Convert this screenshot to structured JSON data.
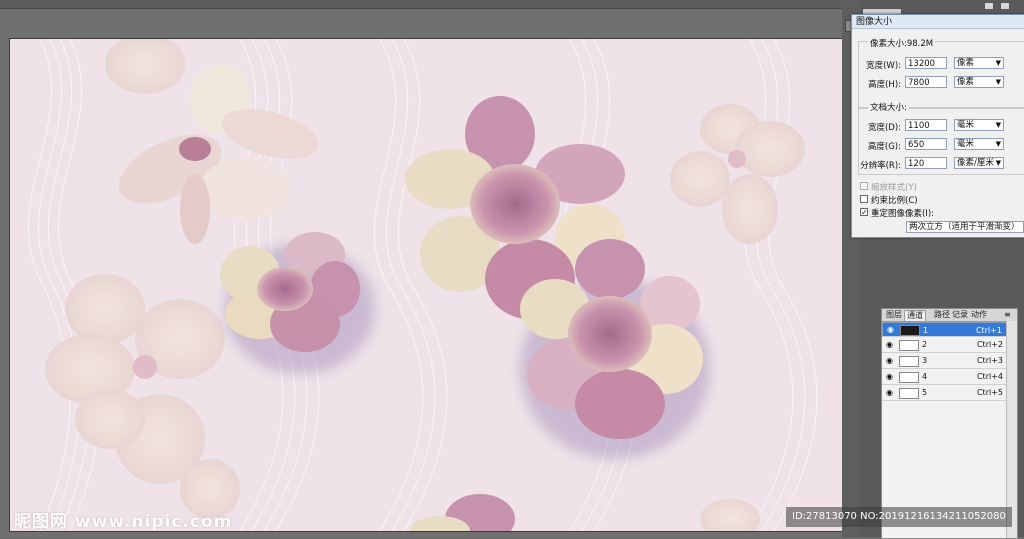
{
  "dialog": {
    "title": "图像大小",
    "pixel_section": "像素大小:98.2M",
    "pixel_width_label": "宽度(W):",
    "pixel_width_value": "13200",
    "pixel_width_unit": "像素",
    "pixel_height_label": "高度(H):",
    "pixel_height_value": "7800",
    "pixel_height_unit": "像素",
    "doc_section": "文档大小:",
    "doc_width_label": "宽度(D):",
    "doc_width_value": "1100",
    "doc_width_unit": "毫米",
    "doc_height_label": "高度(G):",
    "doc_height_value": "650",
    "doc_height_unit": "毫米",
    "resolution_label": "分辨率(R):",
    "resolution_value": "120",
    "resolution_unit": "像素/厘米",
    "scale_styles_label": "缩放样式(Y)",
    "constrain_label": "约束比例(C)",
    "resample_label": "重定图像像素(I):",
    "resample_method": "两次立方（适用于平滑渐变）",
    "constrain_checked": false,
    "resample_checked": true
  },
  "channels_panel": {
    "tabs": [
      "图层",
      "通道",
      "路径",
      "记录",
      "动作"
    ],
    "active_tab": "通道",
    "rows": [
      {
        "name": "1",
        "shortcut": "Ctrl+1",
        "selected": true
      },
      {
        "name": "2",
        "shortcut": "Ctrl+2",
        "selected": false
      },
      {
        "name": "3",
        "shortcut": "Ctrl+3",
        "selected": false
      },
      {
        "name": "4",
        "shortcut": "Ctrl+4",
        "selected": false
      },
      {
        "name": "5",
        "shortcut": "Ctrl+5",
        "selected": false
      }
    ]
  },
  "watermark": {
    "site": "昵图网 www.nipic.com",
    "id_text": "ID:27813070 NO:20191216134211052080"
  },
  "colors": {
    "canvas_bg": "#efe2e8",
    "selection": "#3478d8",
    "dialog_bg": "#f0f0f0"
  }
}
